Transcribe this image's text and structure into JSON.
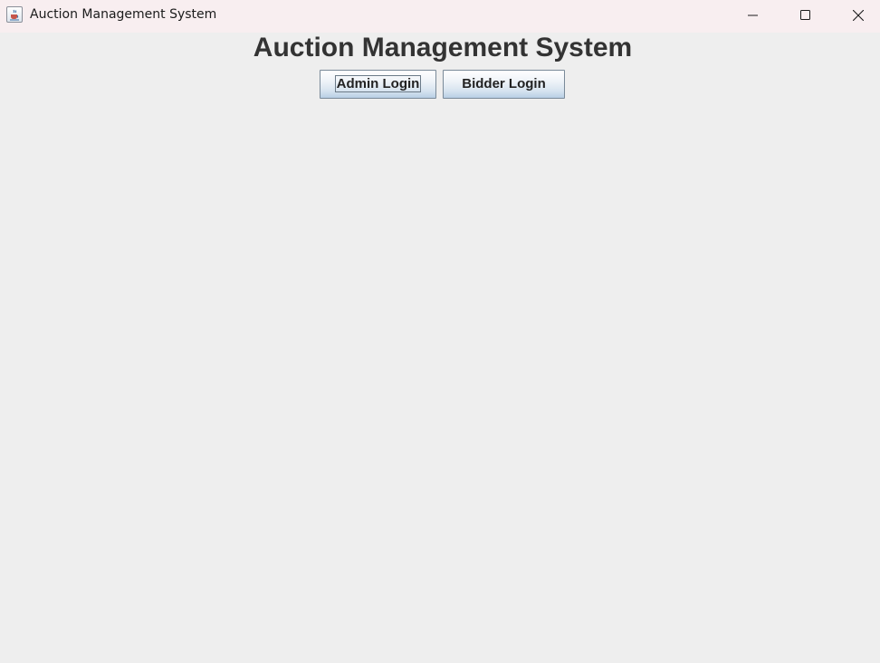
{
  "window": {
    "title": "Auction Management System",
    "icon": "java-cup-icon",
    "controls": {
      "minimize": "minimize-icon",
      "maximize": "maximize-icon",
      "close": "close-icon"
    }
  },
  "main": {
    "heading": "Auction Management System",
    "buttons": {
      "admin_login": "Admin Login",
      "bidder_login": "Bidder Login"
    },
    "focused_button": "admin_login"
  },
  "colors": {
    "title_bar": "#f8eef0",
    "background": "#eeeeee",
    "heading_text": "#333333",
    "button_gradient_top": "#ffffff",
    "button_gradient_bottom": "#b8cfe5",
    "button_border": "#7a8a99"
  }
}
